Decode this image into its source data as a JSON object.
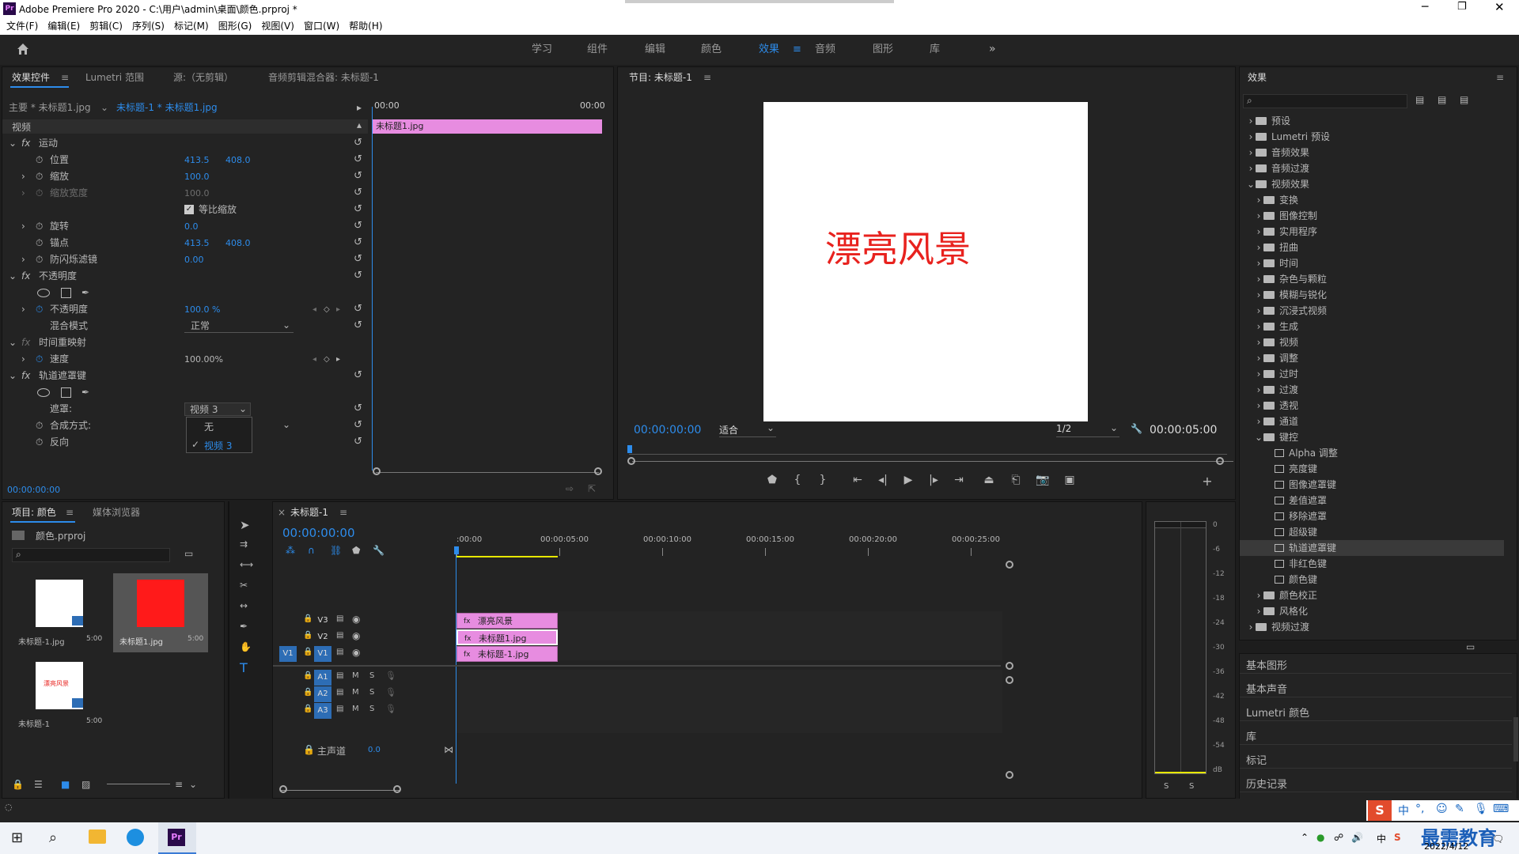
{
  "window": {
    "title": "Adobe Premiere Pro 2020 - C:\\用户\\admin\\桌面\\颜色.prproj *",
    "app_icon": "Pr"
  },
  "menu": [
    "文件(F)",
    "编辑(E)",
    "剪辑(C)",
    "序列(S)",
    "标记(M)",
    "图形(G)",
    "视图(V)",
    "窗口(W)",
    "帮助(H)"
  ],
  "workspaces": [
    "学习",
    "组件",
    "编辑",
    "颜色",
    "效果",
    "音频",
    "图形",
    "库"
  ],
  "workspace_active": "效果",
  "effect_controls": {
    "tabs": [
      "效果控件",
      "Lumetri 范围",
      "源:（无剪辑）",
      "音频剪辑混合器: 未标题-1"
    ],
    "master": "主要 * 未标题1.jpg",
    "clip": "未标题-1 * 未标题1.jpg",
    "tc_start": "00:00",
    "tc_end": "00:00",
    "clip_bar": "未标题1.jpg",
    "section_video": "视频",
    "motion": "运动",
    "position": "位置",
    "pos_x": "413.5",
    "pos_y": "408.0",
    "scale": "缩放",
    "scale_v": "100.0",
    "scale_w": "缩放宽度",
    "scale_w_v": "100.0",
    "uniform": "等比缩放",
    "rotation": "旋转",
    "rotation_v": "0.0",
    "anchor": "锚点",
    "anchor_x": "413.5",
    "anchor_y": "408.0",
    "antiflicker": "防闪烁滤镜",
    "antiflicker_v": "0.00",
    "opacity_group": "不透明度",
    "opacity": "不透明度",
    "opacity_v": "100.0 %",
    "blend": "混合模式",
    "blend_v": "正常",
    "time_remap": "时间重映射",
    "speed": "速度",
    "speed_v": "100.00%",
    "track_matte": "轨道遮罩键",
    "matte": "遮罩:",
    "matte_v": "视频 3",
    "composite": "合成方式:",
    "reverse": "反向",
    "dropdown": [
      "无",
      "视频 3"
    ],
    "timecode": "00:00:00:00"
  },
  "program": {
    "title": "节目: 未标题-1",
    "overlay_text": "漂亮风景",
    "tc_current": "00:00:00:00",
    "fit": "适合",
    "res": "1/2",
    "tc_total": "00:00:05:00"
  },
  "effects_panel": {
    "title": "效果",
    "tree": [
      {
        "label": "预设",
        "level": 0,
        "exp": false,
        "type": "folder"
      },
      {
        "label": "Lumetri 预设",
        "level": 0,
        "exp": false,
        "type": "folder"
      },
      {
        "label": "音频效果",
        "level": 0,
        "exp": false,
        "type": "folder"
      },
      {
        "label": "音频过渡",
        "level": 0,
        "exp": false,
        "type": "folder"
      },
      {
        "label": "视频效果",
        "level": 0,
        "exp": true,
        "type": "folder"
      },
      {
        "label": "变换",
        "level": 1,
        "exp": false,
        "type": "folder"
      },
      {
        "label": "图像控制",
        "level": 1,
        "exp": false,
        "type": "folder"
      },
      {
        "label": "实用程序",
        "level": 1,
        "exp": false,
        "type": "folder"
      },
      {
        "label": "扭曲",
        "level": 1,
        "exp": false,
        "type": "folder"
      },
      {
        "label": "时间",
        "level": 1,
        "exp": false,
        "type": "folder"
      },
      {
        "label": "杂色与颗粒",
        "level": 1,
        "exp": false,
        "type": "folder"
      },
      {
        "label": "模糊与锐化",
        "level": 1,
        "exp": false,
        "type": "folder"
      },
      {
        "label": "沉浸式视频",
        "level": 1,
        "exp": false,
        "type": "folder"
      },
      {
        "label": "生成",
        "level": 1,
        "exp": false,
        "type": "folder"
      },
      {
        "label": "视频",
        "level": 1,
        "exp": false,
        "type": "folder"
      },
      {
        "label": "调整",
        "level": 1,
        "exp": false,
        "type": "folder"
      },
      {
        "label": "过时",
        "level": 1,
        "exp": false,
        "type": "folder"
      },
      {
        "label": "过渡",
        "level": 1,
        "exp": false,
        "type": "folder"
      },
      {
        "label": "透视",
        "level": 1,
        "exp": false,
        "type": "folder"
      },
      {
        "label": "通道",
        "level": 1,
        "exp": false,
        "type": "folder"
      },
      {
        "label": "键控",
        "level": 1,
        "exp": true,
        "type": "folder"
      },
      {
        "label": "Alpha 调整",
        "level": 2,
        "type": "effect"
      },
      {
        "label": "亮度键",
        "level": 2,
        "type": "effect"
      },
      {
        "label": "图像遮罩键",
        "level": 2,
        "type": "effect"
      },
      {
        "label": "差值遮罩",
        "level": 2,
        "type": "effect"
      },
      {
        "label": "移除遮罩",
        "level": 2,
        "type": "effect"
      },
      {
        "label": "超级键",
        "level": 2,
        "type": "effect"
      },
      {
        "label": "轨道遮罩键",
        "level": 2,
        "type": "effect",
        "selected": true
      },
      {
        "label": "非红色键",
        "level": 2,
        "type": "effect"
      },
      {
        "label": "颜色键",
        "level": 2,
        "type": "effect"
      },
      {
        "label": "颜色校正",
        "level": 1,
        "exp": false,
        "type": "folder"
      },
      {
        "label": "风格化",
        "level": 1,
        "exp": false,
        "type": "folder"
      },
      {
        "label": "视频过渡",
        "level": 0,
        "exp": false,
        "type": "folder"
      }
    ],
    "lower": [
      "基本图形",
      "基本声音",
      "Lumetri 颜色",
      "库",
      "标记",
      "历史记录"
    ]
  },
  "project": {
    "tabs": [
      "项目: 颜色",
      "媒体浏览器"
    ],
    "file": "颜色.prproj",
    "items": [
      {
        "name": "未标题-1.jpg",
        "dur": "5:00",
        "color": "#ffffff"
      },
      {
        "name": "未标题1.jpg",
        "dur": "5:00",
        "color": "#ff1a1a"
      },
      {
        "name": "未标题-1",
        "dur": "5:00",
        "color": "#ffffff",
        "text": "漂亮风景"
      }
    ]
  },
  "timeline": {
    "title": "未标题-1",
    "tc": "00:00:00:00",
    "ruler": [
      ":00:00",
      "00:00:05:00",
      "00:00:10:00",
      "00:00:15:00",
      "00:00:20:00",
      "00:00:25:00"
    ],
    "vtracks": [
      "V3",
      "V2",
      "V1"
    ],
    "atracks": [
      "A1",
      "A2",
      "A3"
    ],
    "src_patch": "V1",
    "master": "主声道",
    "master_v": "0.0",
    "clips": [
      "漂亮风景",
      "未标题1.jpg",
      "未标题-1.jpg"
    ]
  },
  "meter": {
    "scale": [
      "0",
      "-6",
      "-12",
      "-18",
      "-24",
      "-30",
      "-36",
      "-42",
      "-48",
      "-54",
      "dB"
    ],
    "solo": [
      "S",
      "S"
    ]
  },
  "taskbar": {
    "date": "2022/4/12",
    "ime": "中",
    "watermark": "最需教育"
  },
  "colors": {
    "accent": "#2d8ceb",
    "clip": "#e78ce0",
    "panel": "#232323"
  }
}
